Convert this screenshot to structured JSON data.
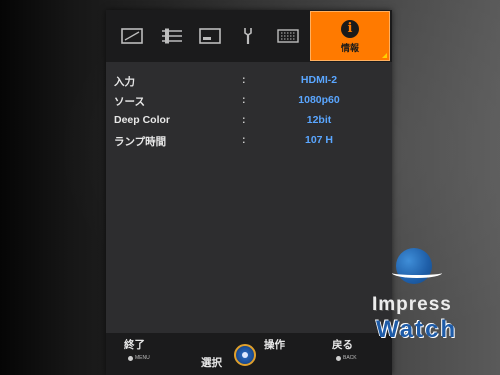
{
  "tabs": [
    {
      "icon": "picture-icon",
      "active": false
    },
    {
      "icon": "sliders-icon",
      "active": false
    },
    {
      "icon": "screen-icon",
      "active": false
    },
    {
      "icon": "wrench-icon",
      "active": false
    },
    {
      "icon": "keypad-icon",
      "active": false
    },
    {
      "icon": "info-icon",
      "label": "情報",
      "active": true
    }
  ],
  "info_rows": [
    {
      "label": "入力",
      "colon": ":",
      "value": "HDMI-2"
    },
    {
      "label": "ソース",
      "colon": ":",
      "value": "1080p60"
    },
    {
      "label": "Deep Color",
      "colon": ":",
      "value": "12bit"
    },
    {
      "label": "ランプ時間",
      "colon": ":",
      "value": "107 H"
    }
  ],
  "footer": {
    "exit_label": "終了",
    "exit_key": "MENU",
    "select_label": "選択",
    "operate_label": "操作",
    "back_label": "戻る",
    "back_key": "BACK"
  },
  "watermark": {
    "line1": "Impress",
    "line2": "Watch"
  },
  "colors": {
    "accent_tab": "#ff7a00",
    "value_text": "#5aa6ff",
    "panel_bg": "#2d2d2f",
    "bar_bg": "#1b1b1c"
  }
}
